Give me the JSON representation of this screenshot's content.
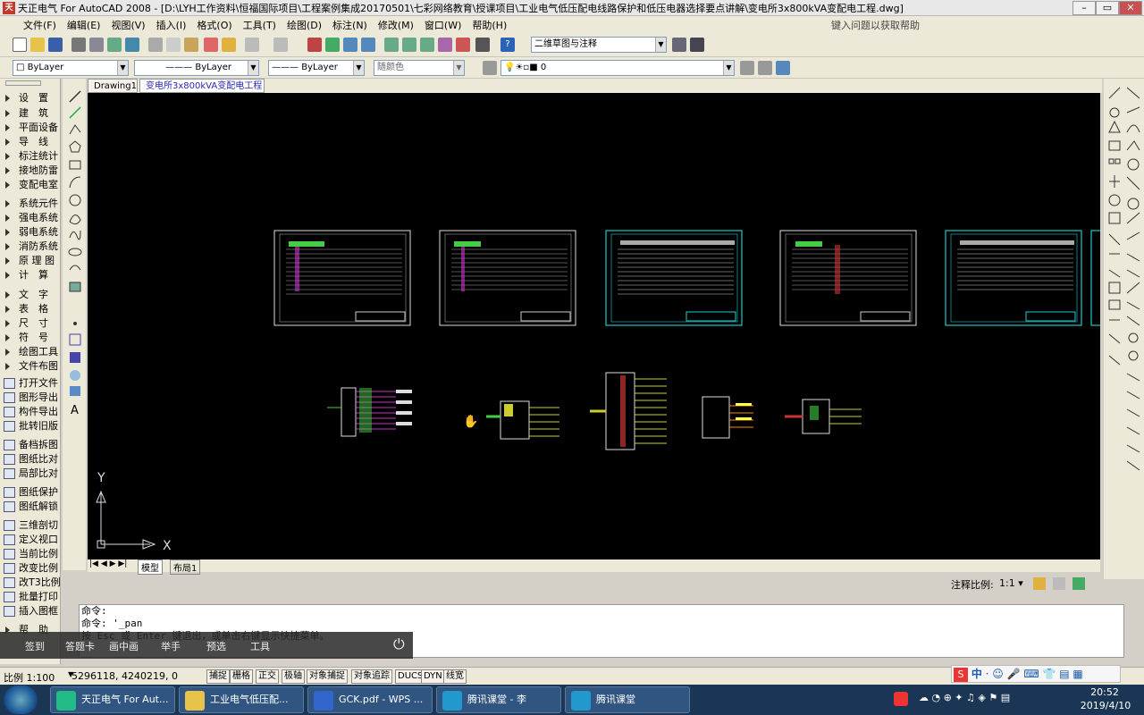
{
  "window": {
    "title": "天正电气 For AutoCAD 2008 - [D:\\LYH工作资料\\恒福国际项目\\工程案例集成20170501\\七彩网络教育\\授课项目\\工业电气低压配电线路保护和低压电器选择要点讲解\\变电所3x800kVA变配电工程.dwg]",
    "help_placeholder": "键入问题以获取帮助"
  },
  "menu": [
    "文件(F)",
    "编辑(E)",
    "视图(V)",
    "插入(I)",
    "格式(O)",
    "工具(T)",
    "绘图(D)",
    "标注(N)",
    "修改(M)",
    "窗口(W)",
    "帮助(H)"
  ],
  "toolbar": {
    "workspace": "二维草图与注释"
  },
  "props": {
    "color": "ByLayer",
    "linetype": "ByLayer",
    "lineweight": "ByLayer",
    "plotstyle": "随颜色",
    "layer": "0"
  },
  "sidebar": [
    {
      "label": "设　置",
      "kind": "arrow"
    },
    {
      "label": "建　筑",
      "kind": "arrow"
    },
    {
      "label": "平面设备",
      "kind": "arrow"
    },
    {
      "label": "导　线",
      "kind": "arrow"
    },
    {
      "label": "标注统计",
      "kind": "arrow"
    },
    {
      "label": "接地防雷",
      "kind": "arrow"
    },
    {
      "label": "变配电室",
      "kind": "arrow"
    },
    {
      "label": "系统元件",
      "kind": "arrow"
    },
    {
      "label": "强电系统",
      "kind": "arrow"
    },
    {
      "label": "弱电系统",
      "kind": "arrow"
    },
    {
      "label": "消防系统",
      "kind": "arrow"
    },
    {
      "label": "原 理 图",
      "kind": "arrow"
    },
    {
      "label": "计　算",
      "kind": "arrow"
    },
    {
      "label": "文　字",
      "kind": "arrow"
    },
    {
      "label": "表　格",
      "kind": "arrow"
    },
    {
      "label": "尺　寸",
      "kind": "arrow"
    },
    {
      "label": "符　号",
      "kind": "arrow"
    },
    {
      "label": "绘图工具",
      "kind": "arrow"
    },
    {
      "label": "文件布图",
      "kind": "arrow"
    },
    {
      "label": "打开文件",
      "kind": "icon"
    },
    {
      "label": "图形导出",
      "kind": "icon"
    },
    {
      "label": "构件导出",
      "kind": "icon"
    },
    {
      "label": "批转旧版",
      "kind": "icon"
    },
    {
      "label": "备档拆图",
      "kind": "icon"
    },
    {
      "label": "图纸比对",
      "kind": "icon"
    },
    {
      "label": "局部比对",
      "kind": "icon"
    },
    {
      "label": "图纸保护",
      "kind": "icon"
    },
    {
      "label": "图纸解锁",
      "kind": "icon"
    },
    {
      "label": "三维剖切",
      "kind": "icon"
    },
    {
      "label": "定义视口",
      "kind": "icon"
    },
    {
      "label": "当前比例",
      "kind": "icon"
    },
    {
      "label": "改变比例",
      "kind": "icon"
    },
    {
      "label": "改T3比例",
      "kind": "icon"
    },
    {
      "label": "批量打印",
      "kind": "icon"
    },
    {
      "label": "插入图框",
      "kind": "icon"
    },
    {
      "label": "帮　助",
      "kind": "arrow"
    }
  ],
  "doc_tabs": [
    "Drawing1",
    "变电所3x800kVA变配电工程"
  ],
  "layout_tabs": [
    "模型",
    "布局1"
  ],
  "ucs": {
    "x": "X",
    "y": "Y"
  },
  "annotation": {
    "label": "注释比例:",
    "value": "1:1"
  },
  "command": [
    "命令:",
    "命令: '_pan",
    "按 Esc 或 Enter 键退出，或单击右键显示快捷菜单。"
  ],
  "overlay": [
    "签到",
    "答题卡",
    "画中画",
    "举手",
    "预选",
    "工具"
  ],
  "status": {
    "scale": "比例 1:100",
    "coords": "5296118, 4240219, 0",
    "buttons": [
      "捕捉",
      "栅格",
      "正交",
      "极轴",
      "对象捕捉",
      "对象追踪",
      "DUCS",
      "DYN",
      "线宽"
    ]
  },
  "taskbar": {
    "tasks": [
      "天正电气 For Aut...",
      "工业电气低压配...",
      "GCK.pdf - WPS ...",
      "腾讯课堂 - 李",
      "腾讯课堂"
    ],
    "time": "20:52",
    "date": "2019/4/10",
    "ime": "中"
  }
}
